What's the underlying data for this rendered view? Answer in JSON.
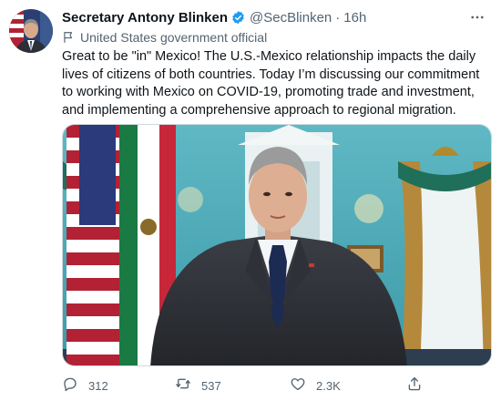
{
  "author": {
    "display_name": "Secretary Antony Blinken",
    "handle": "@SecBlinken",
    "separator": "·",
    "time": "16h",
    "verified_icon": "verified-badge-icon",
    "label": "United States government official",
    "label_icon": "flag-icon"
  },
  "tweet": {
    "text": "Great to be \"in\" Mexico! The U.S.-Mexico relationship impacts the daily lives of citizens of both countries. Today I’m discussing our commitment to working with Mexico on COVID-19, promoting trade and investment, and implementing a comprehensive approach to regional migration."
  },
  "actions": {
    "reply": {
      "icon": "reply-icon",
      "count": "312"
    },
    "retweet": {
      "icon": "retweet-icon",
      "count": "537"
    },
    "like": {
      "icon": "heart-icon",
      "count": "2.3K"
    },
    "share": {
      "icon": "share-icon"
    }
  },
  "colors": {
    "text_primary": "#0f1419",
    "text_secondary": "#536471",
    "verified_blue": "#1d9bf0",
    "border": "#cfd9de"
  }
}
